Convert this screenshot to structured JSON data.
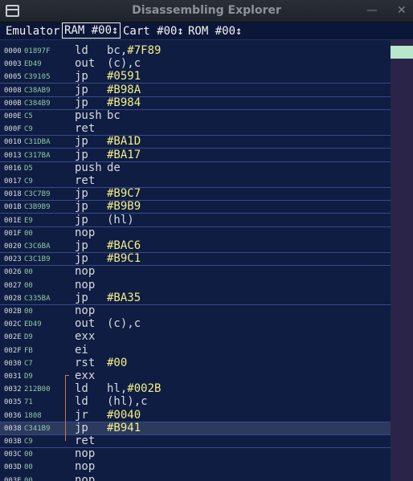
{
  "window": {
    "title": "Disassembling Explorer",
    "min_glyph": "—",
    "close_glyph": "✕"
  },
  "menu": {
    "emulator": "Emulator",
    "ram": "RAM #00↕",
    "cart": "Cart #00↕",
    "rom": "ROM #00↕"
  },
  "rows": [
    {
      "addr": "0000",
      "hex": "01897F",
      "mn": "ld",
      "op": "bc,",
      "num": "#7F89",
      "sep": false
    },
    {
      "addr": "0003",
      "hex": "ED49",
      "mn": "out",
      "op": "(c),c",
      "num": "",
      "sep": false
    },
    {
      "addr": "0005",
      "hex": "C39105",
      "mn": "jp",
      "op": "",
      "num": "#0591",
      "sep": true
    },
    {
      "addr": "0008",
      "hex": "C38AB9",
      "mn": "jp",
      "op": "",
      "num": "#B98A",
      "sep": true
    },
    {
      "addr": "000B",
      "hex": "C384B9",
      "mn": "jp",
      "op": "",
      "num": "#B984",
      "sep": true
    },
    {
      "addr": "000E",
      "hex": "C5",
      "mn": "push",
      "op": "bc",
      "num": "",
      "sep": false
    },
    {
      "addr": "000F",
      "hex": "C9",
      "mn": "ret",
      "op": "",
      "num": "",
      "sep": true
    },
    {
      "addr": "0010",
      "hex": "C31DBA",
      "mn": "jp",
      "op": "",
      "num": "#BA1D",
      "sep": true
    },
    {
      "addr": "0013",
      "hex": "C317BA",
      "mn": "jp",
      "op": "",
      "num": "#BA17",
      "sep": true
    },
    {
      "addr": "0016",
      "hex": "D5",
      "mn": "push",
      "op": "de",
      "num": "",
      "sep": false
    },
    {
      "addr": "0017",
      "hex": "C9",
      "mn": "ret",
      "op": "",
      "num": "",
      "sep": true
    },
    {
      "addr": "0018",
      "hex": "C3C7B9",
      "mn": "jp",
      "op": "",
      "num": "#B9C7",
      "sep": true
    },
    {
      "addr": "001B",
      "hex": "C3B9B9",
      "mn": "jp",
      "op": "",
      "num": "#B9B9",
      "sep": true
    },
    {
      "addr": "001E",
      "hex": "E9",
      "mn": "jp",
      "op": "(hl)",
      "num": "",
      "sep": true
    },
    {
      "addr": "001F",
      "hex": "00",
      "mn": "nop",
      "op": "",
      "num": "",
      "sep": false
    },
    {
      "addr": "0020",
      "hex": "C3C6BA",
      "mn": "jp",
      "op": "",
      "num": "#BAC6",
      "sep": true
    },
    {
      "addr": "0023",
      "hex": "C3C1B9",
      "mn": "jp",
      "op": "",
      "num": "#B9C1",
      "sep": true
    },
    {
      "addr": "0026",
      "hex": "00",
      "mn": "nop",
      "op": "",
      "num": "",
      "sep": false
    },
    {
      "addr": "0027",
      "hex": "00",
      "mn": "nop",
      "op": "",
      "num": "",
      "sep": false
    },
    {
      "addr": "0028",
      "hex": "C335BA",
      "mn": "jp",
      "op": "",
      "num": "#BA35",
      "sep": true
    },
    {
      "addr": "002B",
      "hex": "00",
      "mn": "nop",
      "op": "",
      "num": "",
      "sep": false
    },
    {
      "addr": "002C",
      "hex": "ED49",
      "mn": "out",
      "op": "(c),c",
      "num": "",
      "sep": false
    },
    {
      "addr": "002E",
      "hex": "D9",
      "mn": "exx",
      "op": "",
      "num": "",
      "sep": false
    },
    {
      "addr": "002F",
      "hex": "FB",
      "mn": "ei",
      "op": "",
      "num": "",
      "sep": false
    },
    {
      "addr": "0030",
      "hex": "C7",
      "mn": "rst",
      "op": "",
      "num": "#00",
      "sep": false
    },
    {
      "addr": "0031",
      "hex": "D9",
      "mn": "exx",
      "op": "",
      "num": "",
      "sep": false
    },
    {
      "addr": "0032",
      "hex": "212B00",
      "mn": "ld",
      "op": "hl,",
      "num": "#002B",
      "sep": false
    },
    {
      "addr": "0035",
      "hex": "71",
      "mn": "ld",
      "op": "(hl),c",
      "num": "",
      "sep": false
    },
    {
      "addr": "0036",
      "hex": "1808",
      "mn": "jr",
      "op": "",
      "num": "#0040",
      "sep": true
    },
    {
      "addr": "0038",
      "hex": "C341B9",
      "mn": "jp",
      "op": "",
      "num": "#B941",
      "sep": true,
      "current": true
    },
    {
      "addr": "003B",
      "hex": "C9",
      "mn": "ret",
      "op": "",
      "num": "",
      "sep": true
    },
    {
      "addr": "003C",
      "hex": "00",
      "mn": "nop",
      "op": "",
      "num": "",
      "sep": false
    },
    {
      "addr": "003D",
      "hex": "00",
      "mn": "nop",
      "op": "",
      "num": "",
      "sep": false
    },
    {
      "addr": "003E",
      "hex": "00",
      "mn": "nop",
      "op": "",
      "num": "",
      "sep": false
    }
  ]
}
